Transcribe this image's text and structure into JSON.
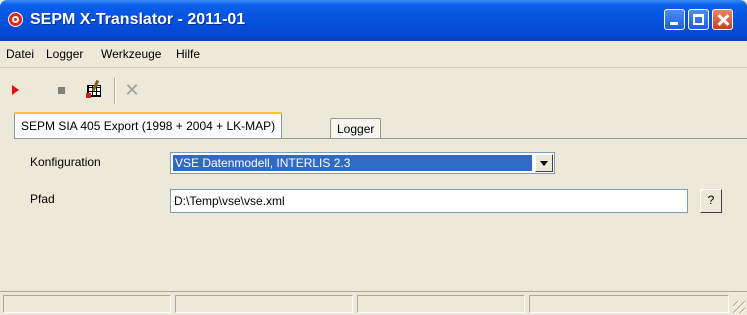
{
  "window": {
    "title": "SEPM X-Translator - 2011-01"
  },
  "menu": {
    "items": [
      "Datei",
      "Logger",
      "Werkzeuge",
      "Hilfe"
    ]
  },
  "toolbar": {
    "icons": [
      "play-icon",
      "stop-icon",
      "export-icon",
      "delete-icon"
    ]
  },
  "tabs": [
    {
      "label": "SEPM SIA 405 Export (1998 + 2004 + LK-MAP)"
    },
    {
      "label": "Logger"
    }
  ],
  "form": {
    "konfiguration_label": "Konfiguration",
    "konfiguration_value": "VSE Datenmodell, INTERLIS 2.3",
    "pfad_label": "Pfad",
    "pfad_value": "D:\\Temp\\vse\\vse.xml",
    "browse_label": "?"
  },
  "colors": {
    "titlebar": "#0551de",
    "selection": "#316ac5",
    "close_button": "#c8421c"
  }
}
